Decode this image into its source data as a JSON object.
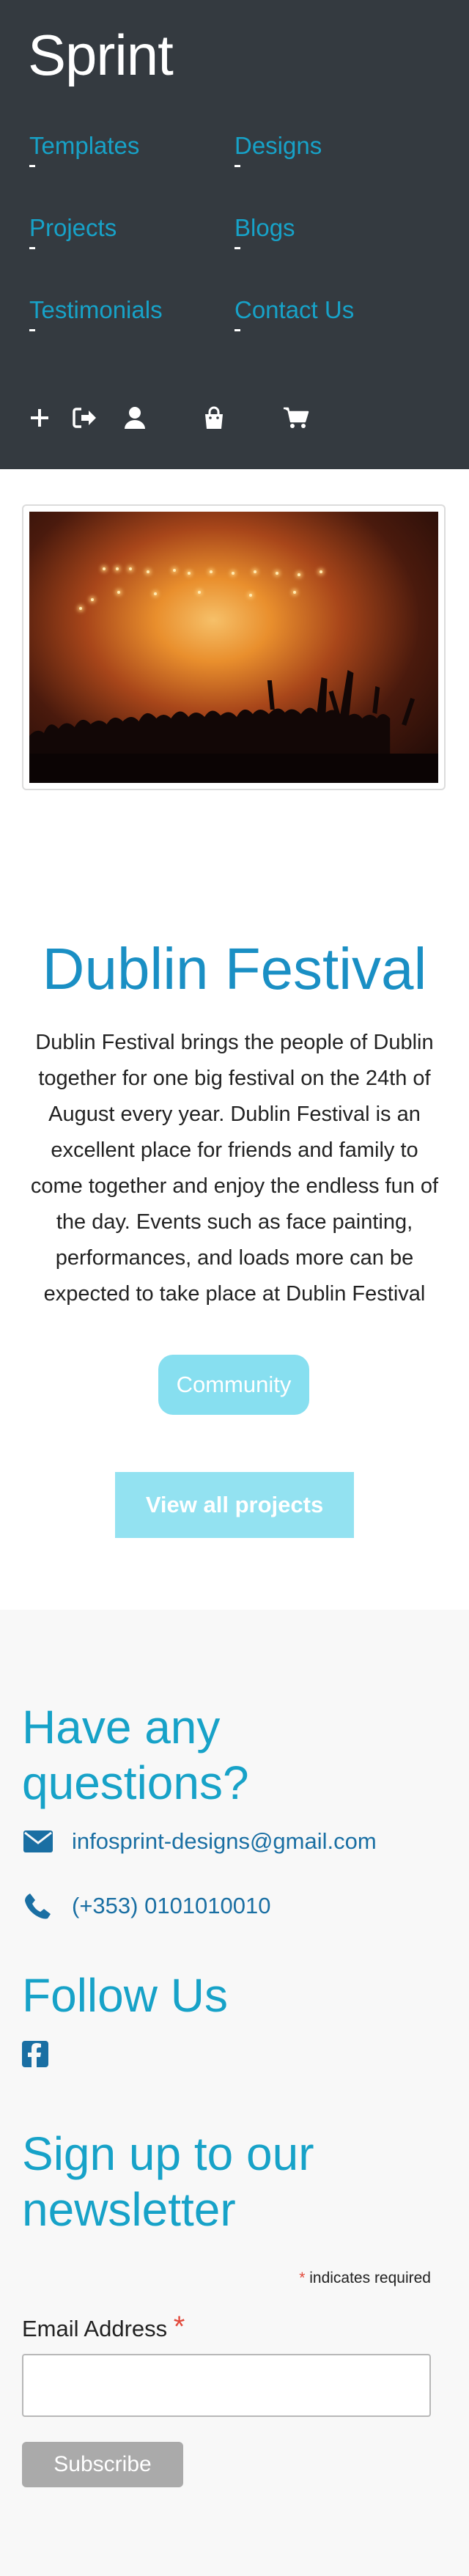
{
  "header": {
    "brand": "Sprint",
    "nav": [
      {
        "label": "Templates"
      },
      {
        "label": "Designs"
      },
      {
        "label": "Projects"
      },
      {
        "label": "Blogs"
      },
      {
        "label": "Testimonials"
      },
      {
        "label": "Contact Us"
      }
    ],
    "icons": [
      "plus-icon",
      "sign-in-icon",
      "user-icon",
      "shopping-bag-icon",
      "shopping-cart-icon"
    ]
  },
  "festival": {
    "title": "Dublin Festival",
    "description": "Dublin Festival brings the people of Dublin together for one big festival on the 24th of August every year. Dublin Festival is an excellent place for friends and family to come together and enjoy the endless fun of the day. Events such as face painting, performances, and loads more can be expected to take place at Dublin Festival",
    "tag_label": "Community",
    "view_all_label": "View all projects"
  },
  "footer": {
    "questions_heading": "Have any questions?",
    "email": "infosprint-designs@gmail.com",
    "phone": "(+353) 0101010010",
    "follow_heading": "Follow Us",
    "newsletter_heading": "Sign up to our newsletter",
    "required_star": "*",
    "required_note": " indicates required",
    "email_label": "Email Address",
    "email_value": "",
    "subscribe_label": "Subscribe"
  },
  "colors": {
    "header_bg": "#343a40",
    "accent": "#17a2c8",
    "button_light": "#87dff0",
    "footer_bg": "#f8f8f8"
  }
}
